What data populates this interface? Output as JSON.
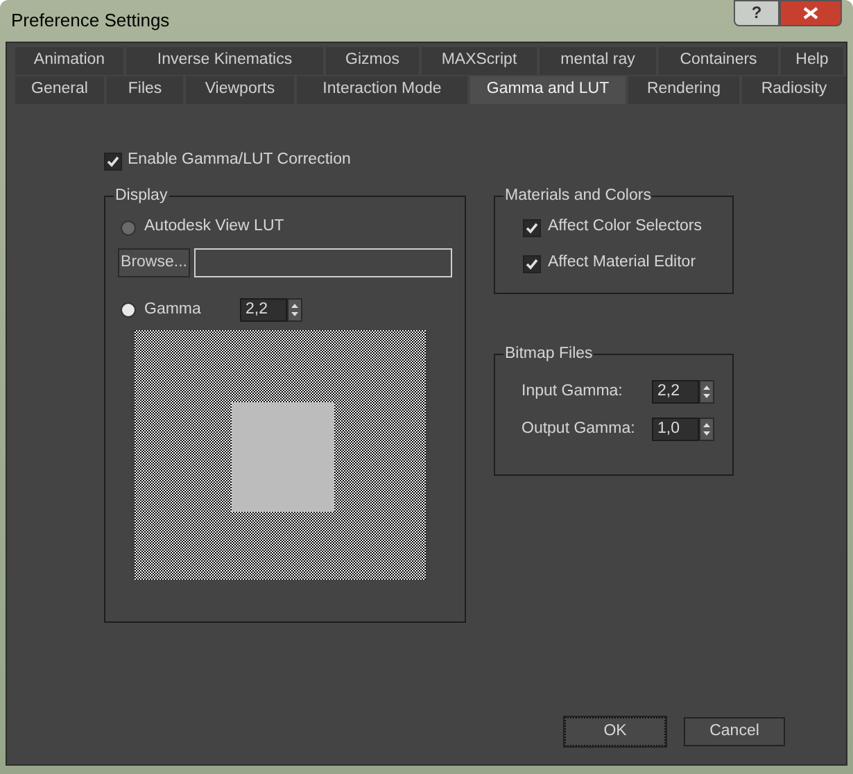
{
  "window": {
    "title": "Preference Settings",
    "help_button": "?"
  },
  "tab_rows": [
    [
      {
        "label": "Animation",
        "selected": false
      },
      {
        "label": "Inverse Kinematics",
        "selected": false
      },
      {
        "label": "Gizmos",
        "selected": false
      },
      {
        "label": "MAXScript",
        "selected": false
      },
      {
        "label": "mental ray",
        "selected": false
      },
      {
        "label": "Containers",
        "selected": false
      },
      {
        "label": "Help",
        "selected": false
      }
    ],
    [
      {
        "label": "General",
        "selected": false
      },
      {
        "label": "Files",
        "selected": false
      },
      {
        "label": "Viewports",
        "selected": false
      },
      {
        "label": "Interaction Mode",
        "selected": false
      },
      {
        "label": "Gamma and LUT",
        "selected": true
      },
      {
        "label": "Rendering",
        "selected": false
      },
      {
        "label": "Radiosity",
        "selected": false
      }
    ]
  ],
  "enable": {
    "label": "Enable Gamma/LUT Correction",
    "checked": true
  },
  "display": {
    "title": "Display",
    "lut": {
      "label": "Autodesk View LUT",
      "selected": false
    },
    "browse": "Browse...",
    "gamma": {
      "label": "Gamma",
      "selected": true,
      "value": "2,2"
    }
  },
  "materials": {
    "title": "Materials and Colors",
    "items": [
      {
        "label": "Affect Color Selectors",
        "checked": true
      },
      {
        "label": "Affect Material Editor",
        "checked": true
      }
    ]
  },
  "bitmap": {
    "title": "Bitmap Files",
    "fields": [
      {
        "label": "Input Gamma:",
        "value": "2,2"
      },
      {
        "label": "Output Gamma:",
        "value": "1,0"
      }
    ]
  },
  "buttons": [
    {
      "label": "OK",
      "default": true
    },
    {
      "label": "Cancel",
      "default": false
    }
  ]
}
